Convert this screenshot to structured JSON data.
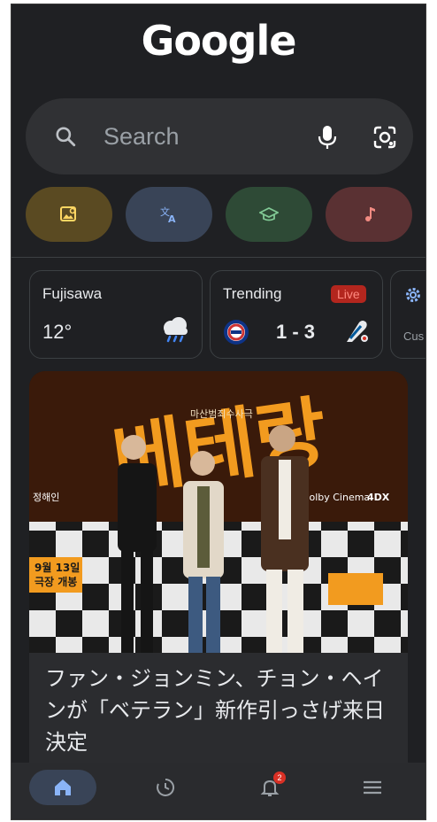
{
  "header": {
    "logo_text": "Google"
  },
  "search": {
    "placeholder": "Search",
    "icons": [
      "search-icon",
      "mic-icon",
      "lens-icon"
    ]
  },
  "shortcuts": [
    {
      "icon": "image-search-icon",
      "color": "#5a4a22"
    },
    {
      "icon": "translate-icon",
      "color": "#394457"
    },
    {
      "icon": "education-icon",
      "color": "#2e4a36"
    },
    {
      "icon": "music-icon",
      "color": "#5a3133"
    }
  ],
  "cards": {
    "weather": {
      "location": "Fujisawa",
      "temperature": "12°",
      "icon": "rain-cloud-icon"
    },
    "trending": {
      "label": "Trending",
      "status": "Live",
      "score": "1 - 3",
      "home_team_icon": "cubs-logo-icon",
      "away_team_icon": "dodgers-logo-icon"
    },
    "customize": {
      "label": "Cus",
      "icon": "gear-icon"
    }
  },
  "news": {
    "headline": "ファン・ジョンミン、チョン・ヘインが「ベテラン」新作引っさげ来日決定",
    "image": {
      "poster_text": "베테랑",
      "poster_subtitle": "마산범죄수사극",
      "release_text_1": "9월 13일",
      "release_text_2": "극장 개봉",
      "brand_text": "Dolby Cinema",
      "brand_text_2": "4DX",
      "name_text": "정해인"
    }
  },
  "bottom_nav": {
    "items": [
      {
        "icon": "home-icon",
        "active": true
      },
      {
        "icon": "history-icon",
        "active": false
      },
      {
        "icon": "notifications-icon",
        "active": false,
        "badge": "2"
      },
      {
        "icon": "menu-icon",
        "active": false
      }
    ]
  }
}
